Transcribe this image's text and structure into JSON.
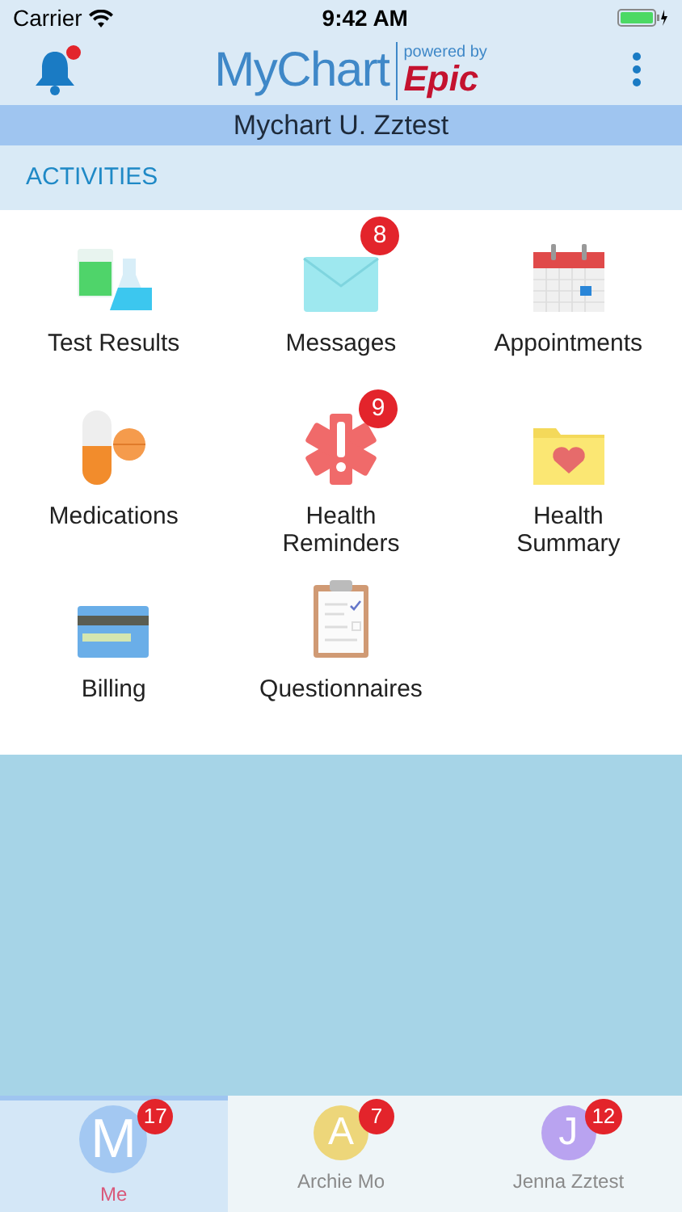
{
  "status_bar": {
    "carrier": "Carrier",
    "time": "9:42 AM"
  },
  "header": {
    "logo": "MyChart",
    "powered_by": "powered by",
    "brand": "Epic",
    "bell_dot": true
  },
  "patient_name": "Mychart U. Zztest",
  "section_title": "ACTIVITIES",
  "activities": [
    {
      "label": "Test Results"
    },
    {
      "label": "Messages",
      "badge": "8"
    },
    {
      "label": "Appointments"
    },
    {
      "label": "Medications"
    },
    {
      "label": "Health Reminders",
      "badge": "9"
    },
    {
      "label": "Health Summary"
    },
    {
      "label": "Billing"
    },
    {
      "label": "Questionnaires"
    }
  ],
  "tabs": [
    {
      "initial": "M",
      "name": "Me",
      "badge": "17",
      "color": "#a3c8f2",
      "selected": true
    },
    {
      "initial": "A",
      "name": "Archie Mo",
      "badge": "7",
      "color": "#edd67a",
      "selected": false
    },
    {
      "initial": "J",
      "name": "Jenna Zztest",
      "badge": "12",
      "color": "#b9a3f0",
      "selected": false
    }
  ]
}
